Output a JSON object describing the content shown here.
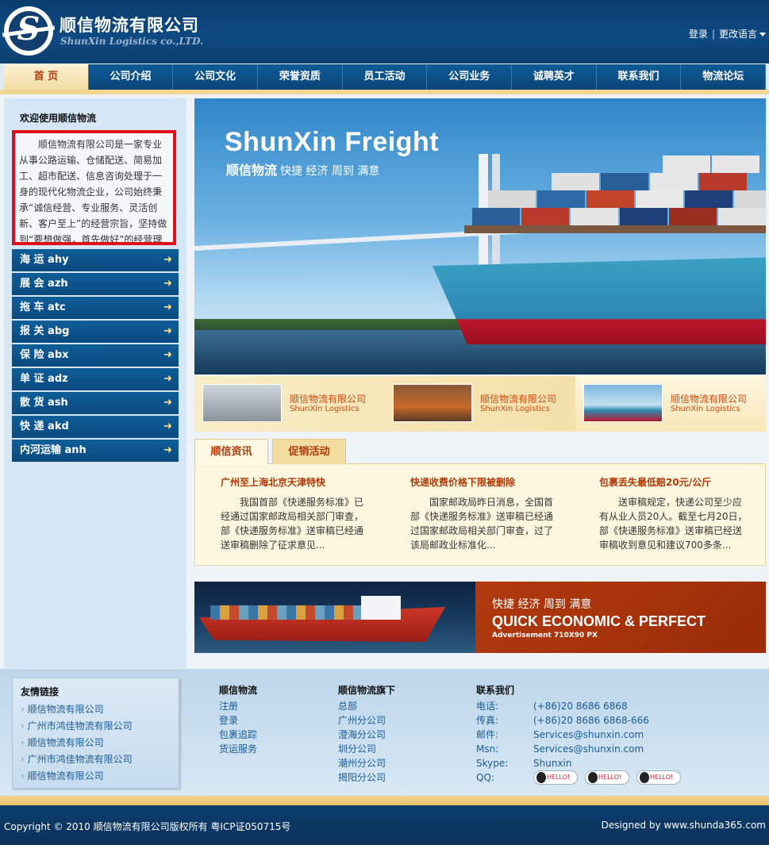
{
  "header": {
    "company_cn": "顺信物流有限公司",
    "company_en": "ShunXin Logistics co.,LTD.",
    "login": "登录",
    "language": "更改语言"
  },
  "nav": {
    "items": [
      "首 页",
      "公司介绍",
      "公司文化",
      "荣誉资质",
      "员工活动",
      "公司业务",
      "诚聘英才",
      "联系我们",
      "物流论坛"
    ]
  },
  "sidebar": {
    "welcome_title": "欢迎使用顺信物流",
    "intro": "顺信物流有限公司是一家专业从事公路运输、仓储配送、简易加工、超市配送、信息咨询处理于一身的现代化物流企业，公司始终秉承“诚信经营、专业服务、灵活创新、客户至上”的经营宗旨，坚持做到“要想做强，首先做好”的经营理念。",
    "menu": [
      {
        "label": "海 运 ahy"
      },
      {
        "label": "展 会 azh"
      },
      {
        "label": "拖 车 atc"
      },
      {
        "label": "报 关 abg"
      },
      {
        "label": "保 险 abx"
      },
      {
        "label": "单 证 adz"
      },
      {
        "label": "散 货 ash"
      },
      {
        "label": "快 递 akd"
      },
      {
        "label": "内河运输 anh"
      }
    ]
  },
  "banner": {
    "title": "ShunXin Freight",
    "sub_bold": "顺信物流",
    "sub": "快捷 经济 周到 满意"
  },
  "thumbs": [
    {
      "t1": "顺信物流有限公司",
      "t2": "ShunXin Logistics"
    },
    {
      "t1": "顺信物流有限公司",
      "t2": "ShunXin Logistics"
    },
    {
      "t1": "顺信物流有限公司",
      "t2": "ShunXin Logistics"
    }
  ],
  "news": {
    "tabs": [
      "顺信资讯",
      "促销活动"
    ],
    "items": [
      {
        "title": "广州至上海北京天津特快",
        "body": "我国首部《快递服务标准》已经通过国家邮政局相关部门审查，部《快递服务标准》送审稿已经通送审稿删除了征求意见..."
      },
      {
        "title": "快递收费价格下限被删除",
        "body": "国家邮政局昨日消息，全国首部《快递服务标准》送审稿已经通过国家邮政局相关部门审查，过了该局邮政业标准化..."
      },
      {
        "title": "包裹丢失最低赔20元/公斤",
        "body": "送审稿规定，快递公司至少应有从业人员20人。截至七月20日，部《快递服务标准》送审稿已经送审稿收到意见和建议700多条..."
      }
    ]
  },
  "ad": {
    "line1": "快捷 经济 周到 满意",
    "line2": "QUICK ECONOMIC & PERFECT",
    "line3": "Advertisement 710X90 PX"
  },
  "footer": {
    "links_title": "友情链接",
    "links": [
      "顺信物流有限公司",
      "广州市鸿佳物流有限公司",
      "顺信物流有限公司",
      "广州市鸿佳物流有限公司",
      "顺信物流有限公司"
    ],
    "col1_title": "顺信物流",
    "col1": [
      "注册",
      "登录",
      "包裹追踪",
      "货运服务"
    ],
    "col2_title": "顺信物流旗下",
    "col2": [
      "总部",
      "广州分公司",
      "澄海分公司",
      "圳分公司",
      "潮州分公司",
      "揭阳分公司"
    ],
    "contact_title": "联系我们",
    "contact": [
      {
        "label": "电话:",
        "value": "(+86)20 8686 6868"
      },
      {
        "label": "传真:",
        "value": "(+86)20 8686 6868-666"
      },
      {
        "label": "邮件:",
        "value": "Services@shunxin.com"
      },
      {
        "label": "Msn:",
        "value": "Services@shunxin.com"
      },
      {
        "label": "Skype:",
        "value": "Shunxin"
      },
      {
        "label": "QQ:",
        "value": ""
      }
    ],
    "qq_buttons": [
      "HELLO!",
      "HELLO!",
      "HELLO!"
    ]
  },
  "bottom": {
    "copyright": "Copyright © 2010 顺信物流有限公司版权所有  粤ICP证050715号",
    "designed": "Designed by www.shunda365.com"
  }
}
